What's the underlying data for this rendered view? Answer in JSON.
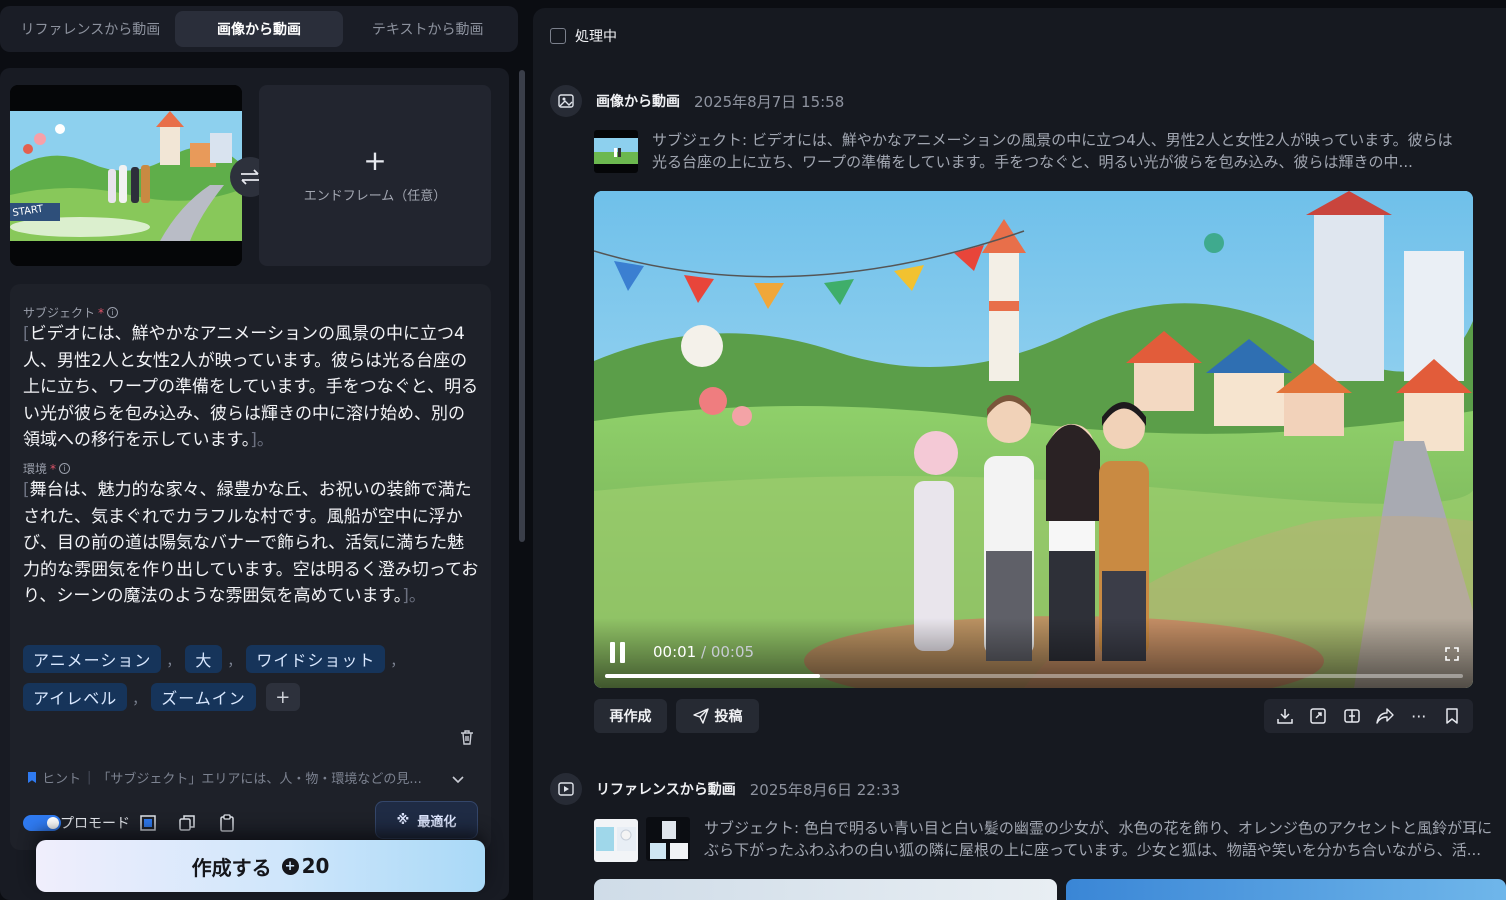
{
  "tabs": [
    {
      "label": "リファレンスから動画",
      "active": false
    },
    {
      "label": "画像から動画",
      "active": true
    },
    {
      "label": "テキストから動画",
      "active": false
    }
  ],
  "frames": {
    "start_label": "START",
    "end_label": "エンドフレーム（任意）"
  },
  "subject": {
    "label": "サブジェクト",
    "required_mark": "*",
    "text": "ビデオには、鮮やかなアニメーションの風景の中に立つ4人、男性2人と女性2人が映っています。彼らは光る台座の上に立ち、ワープの準備をしています。手をつなぐと、明るい光が彼らを包み込み、彼らは輝きの中に溶け始め、別の領域への移行を示しています。"
  },
  "environment": {
    "label": "環境",
    "required_mark": "*",
    "text": "舞台は、魅力的な家々、緑豊かな丘、お祝いの装飾で満たされた、気まぐれでカラフルな村です。風船が空中に浮かび、目の前の道は陽気なバナーで飾られ、活気に満ちた魅力的な雰囲気を作り出しています。空は明るく澄み切っており、シーンの魔法のような雰囲気を高めています。"
  },
  "bracket_open": "[",
  "bracket_close": "]。",
  "chips": [
    "アニメーション",
    "大",
    "ワイドショット",
    "アイレベル",
    "ズームイン"
  ],
  "chip_separator": "，",
  "chip_add": "+",
  "hint": {
    "label": "ヒント",
    "separator": "|",
    "text": "「サブジェクト」エリアには、人・物・環境などの見..."
  },
  "pro_mode": {
    "label": "プロモード",
    "enabled": true
  },
  "optimize_label": "最適化",
  "create": {
    "label": "作成する",
    "credits": "20",
    "coin_glyph": "+"
  },
  "right": {
    "processing_label": "処理中",
    "gen1": {
      "title": "画像から動画",
      "date": "2025年8月7日 15:58",
      "description": "サブジェクト: ビデオには、鮮やかなアニメーションの風景の中に立つ4人、男性2人と女性2人が映っています。彼らは光る台座の上に立ち、ワープの準備をしています。手をつなぐと、明るい光が彼らを包み込み、彼らは輝きの中...",
      "video": {
        "current": "00:01",
        "total": "/ 00:05",
        "progress": 0.25
      },
      "regenerate_label": "再作成",
      "post_label": "投稿",
      "actions": [
        "download-icon",
        "upscale-icon",
        "extend-icon",
        "share-icon",
        "more-icon",
        "bookmark-icon"
      ],
      "more_glyph": "···"
    },
    "gen2": {
      "title": "リファレンスから動画",
      "date": "2025年8月6日 22:33",
      "description": "サブジェクト: 色白で明るい青い目と白い髪の幽霊の少女が、水色の花を飾り、オレンジ色のアクセントと風鈴が耳にぶら下がったふわふわの白い狐の隣に屋根の上に座っています。少女と狐は、物語や笑いを分かち合いながら、活..."
    }
  },
  "colors": {
    "accent": "#2f7af0",
    "chip_bg": "#16345a",
    "panel": "#181b23",
    "create_gradient_end": "#a9d9f7"
  }
}
